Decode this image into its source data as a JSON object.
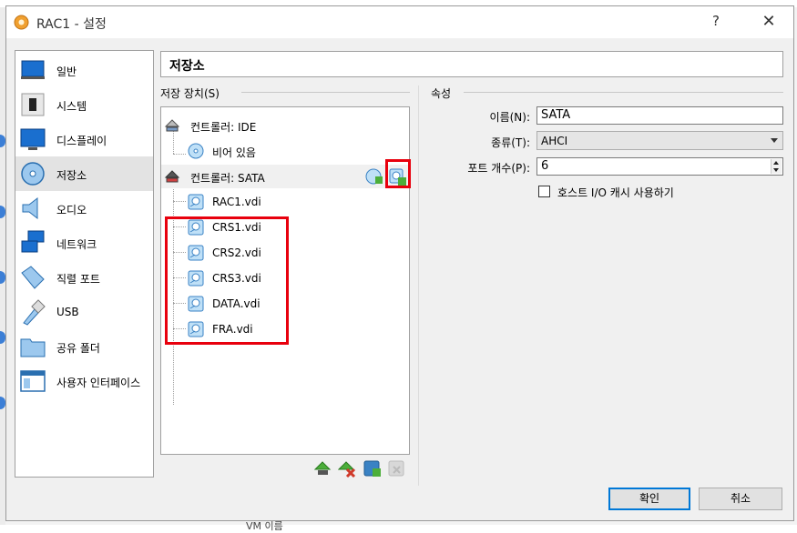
{
  "background": {
    "bottom_text": "VM 이름"
  },
  "window": {
    "title": "RAC1 - 설정",
    "help_label": "?",
    "close_label": "✕"
  },
  "sidebar": {
    "items": [
      {
        "label": "일반",
        "icon": "general-icon"
      },
      {
        "label": "시스템",
        "icon": "system-chip-icon"
      },
      {
        "label": "디스플레이",
        "icon": "display-monitor-icon"
      },
      {
        "label": "저장소",
        "icon": "storage-disk-icon",
        "active": true
      },
      {
        "label": "오디오",
        "icon": "speaker-icon"
      },
      {
        "label": "네트워크",
        "icon": "network-icon"
      },
      {
        "label": "직렬 포트",
        "icon": "serial-port-icon"
      },
      {
        "label": "USB",
        "icon": "usb-icon"
      },
      {
        "label": "공유 폴더",
        "icon": "folder-icon"
      },
      {
        "label": "사용자 인터페이스",
        "icon": "user-interface-icon"
      }
    ]
  },
  "section": {
    "title": "저장소"
  },
  "storage_devices": {
    "label": "저장 장치(S)",
    "tree": [
      {
        "label": "컨트롤러: IDE",
        "type": "controller"
      },
      {
        "label": "비어 있음",
        "type": "optical-empty"
      },
      {
        "label": "컨트롤러: SATA",
        "type": "controller",
        "selected": true
      },
      {
        "label": "RAC1.vdi",
        "type": "disk"
      },
      {
        "label": "CRS1.vdi",
        "type": "disk"
      },
      {
        "label": "CRS2.vdi",
        "type": "disk"
      },
      {
        "label": "CRS3.vdi",
        "type": "disk"
      },
      {
        "label": "DATA.vdi",
        "type": "disk"
      },
      {
        "label": "FRA.vdi",
        "type": "disk"
      }
    ],
    "add_optical_icon": "add-optical-drive-icon",
    "add_hard_disk_icon": "add-hard-disk-icon",
    "bottom_tools": [
      {
        "icon": "add-controller-icon"
      },
      {
        "icon": "remove-controller-icon"
      },
      {
        "icon": "add-attachment-icon"
      },
      {
        "icon": "remove-attachment-icon",
        "disabled": true
      }
    ]
  },
  "attributes": {
    "label": "속성",
    "name_label": "이름(N):",
    "name_value": "SATA",
    "type_label": "종류(T):",
    "type_value": "AHCI",
    "port_label": "포트 개수(P):",
    "port_value": "6",
    "host_io_cache_label": "호스트 I/O 캐시 사용하기",
    "host_io_cache_checked": false
  },
  "buttons": {
    "ok": "확인",
    "cancel": "취소"
  },
  "colors": {
    "highlight_box": "#e8000d",
    "default_button_border": "#0078d7",
    "icon_blue": "#3c7fd6"
  }
}
